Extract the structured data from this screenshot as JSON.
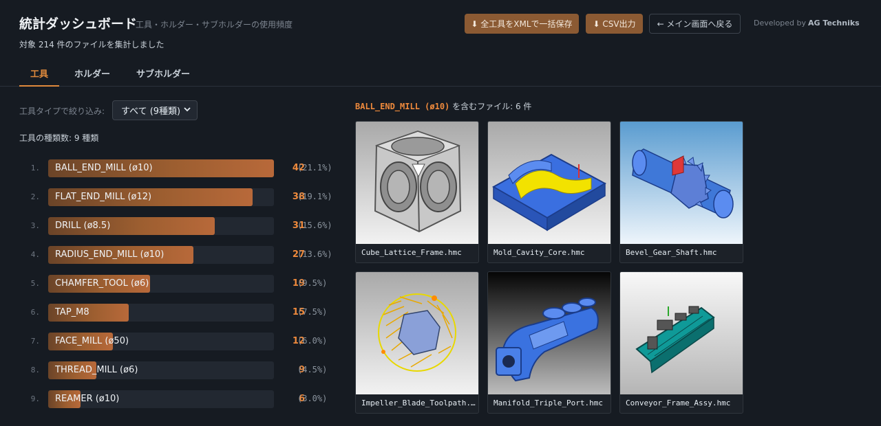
{
  "header": {
    "title": "統計ダッシュボード",
    "subtitle": "工具・ホルダー・サブホルダーの使用頻度",
    "summary": "対象 214 件のファイルを集計しました",
    "buttons": {
      "export_xml": "⬇ 全工具をXMLで一括保存",
      "export_csv": "⬇ CSV出力",
      "back": "← メイン画面へ戻る"
    },
    "credit_prefix": "Developed by",
    "credit_name": "AG Techniks"
  },
  "tabs": [
    {
      "label": "工具",
      "active": true
    },
    {
      "label": "ホルダー",
      "active": false
    },
    {
      "label": "サブホルダー",
      "active": false
    }
  ],
  "filter": {
    "label": "工具タイプで絞り込み:",
    "selected": "すべて (9種類)"
  },
  "tool_count_label": "工具の種類数: 9 種類",
  "tools": [
    {
      "rank": "1.",
      "name": "BALL_END_MILL (ø10)",
      "count": "42",
      "pct": "(21.1%)",
      "share": 1.0
    },
    {
      "rank": "2.",
      "name": "FLAT_END_MILL (ø12)",
      "count": "38",
      "pct": "(19.1%)",
      "share": 0.905
    },
    {
      "rank": "3.",
      "name": "DRILL (ø8.5)",
      "count": "31",
      "pct": "(15.6%)",
      "share": 0.738
    },
    {
      "rank": "4.",
      "name": "RADIUS_END_MILL (ø10)",
      "count": "27",
      "pct": "(13.6%)",
      "share": 0.643
    },
    {
      "rank": "5.",
      "name": "CHAMFER_TOOL (ø6)",
      "count": "19",
      "pct": "(9.5%)",
      "share": 0.452
    },
    {
      "rank": "6.",
      "name": "TAP_M8",
      "count": "15",
      "pct": "(7.5%)",
      "share": 0.357
    },
    {
      "rank": "7.",
      "name": "FACE_MILL (ø50)",
      "count": "12",
      "pct": "(6.0%)",
      "share": 0.286
    },
    {
      "rank": "8.",
      "name": "THREAD_MILL (ø6)",
      "count": "9",
      "pct": "(4.5%)",
      "share": 0.214
    },
    {
      "rank": "9.",
      "name": "REAMER (ø10)",
      "count": "6",
      "pct": "(3.0%)",
      "share": 0.143
    }
  ],
  "files_panel": {
    "selected_tool": "BALL_END_MILL (ø10)",
    "suffix": " を含むファイル: 6 件",
    "files": [
      {
        "name": "Cube_Lattice_Frame.hmc",
        "thumb": "cube-lattice-icon"
      },
      {
        "name": "Mold_Cavity_Core.hmc",
        "thumb": "mold-cavity-icon"
      },
      {
        "name": "Bevel_Gear_Shaft.hmc",
        "thumb": "bevel-gear-icon"
      },
      {
        "name": "Impeller_Blade_Toolpath.hmc",
        "thumb": "impeller-toolpath-icon"
      },
      {
        "name": "Manifold_Triple_Port.hmc",
        "thumb": "manifold-icon"
      },
      {
        "name": "Conveyor_Frame_Assy.hmc",
        "thumb": "conveyor-icon"
      }
    ]
  },
  "colors": {
    "accent": "#ef8a3c",
    "bar": "#9c5e30",
    "button": "#8b5a33",
    "background": "#161b22"
  }
}
